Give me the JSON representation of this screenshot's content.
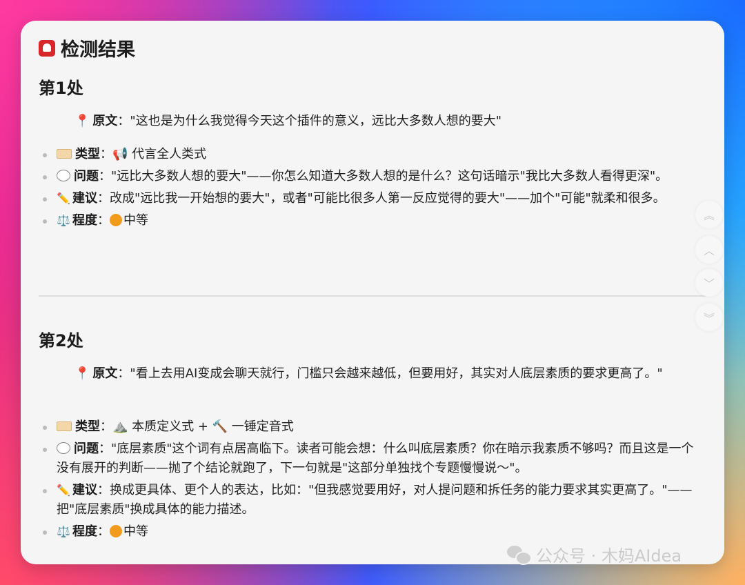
{
  "title": "检测结果",
  "sections": [
    {
      "heading": "第1处",
      "original_label": "原文",
      "original_text": "：\"这也是为什么我觉得今天这个插件的意义，远比大多数人想的要大\"",
      "items": [
        {
          "label": "类型",
          "text": "：📢 代言全人类式"
        },
        {
          "label": "问题",
          "text": "：\"远比大多数人想的要大\"——你怎么知道大多数人想的是什么？这句话暗示\"我比大多数人看得更深\"。"
        },
        {
          "label": "建议",
          "text": "：改成\"远比我一开始想的要大\"，或者\"可能比很多人第一反应觉得的要大\"——加个\"可能\"就柔和很多。"
        },
        {
          "label": "程度",
          "text": "中等"
        }
      ]
    },
    {
      "heading": "第2处",
      "original_label": "原文",
      "original_text": "：\"看上去用AI变成会聊天就行，门槛只会越来越低，但要用好，其实对人底层素质的要求更高了。\"",
      "items": [
        {
          "label": "类型",
          "text": "：⛰️ 本质定义式 + 🔨 一锤定音式"
        },
        {
          "label": "问题",
          "text": "：\"底层素质\"这个词有点居高临下。读者可能会想：什么叫底层素质？你在暗示我素质不够吗？而且这是一个没有展开的判断——抛了个结论就跑了，下一句就是\"这部分单独找个专题慢慢说～\"。"
        },
        {
          "label": "建议",
          "text": "：换成更具体、更个人的表达，比如：\"但我感觉要用好，对人提问题和拆任务的能力要求其实更高了。\"——把\"底层素质\"换成具体的能力描述。"
        },
        {
          "label": "程度",
          "text": "中等"
        }
      ]
    }
  ],
  "watermark": "公众号 · 木妈AIdea",
  "nav_icons": [
    "double-chevron-up-icon",
    "chevron-up-icon",
    "chevron-down-icon",
    "double-chevron-down-icon"
  ],
  "colors": {
    "accent_red": "#d8272b",
    "level_orange": "#f29a1a"
  }
}
